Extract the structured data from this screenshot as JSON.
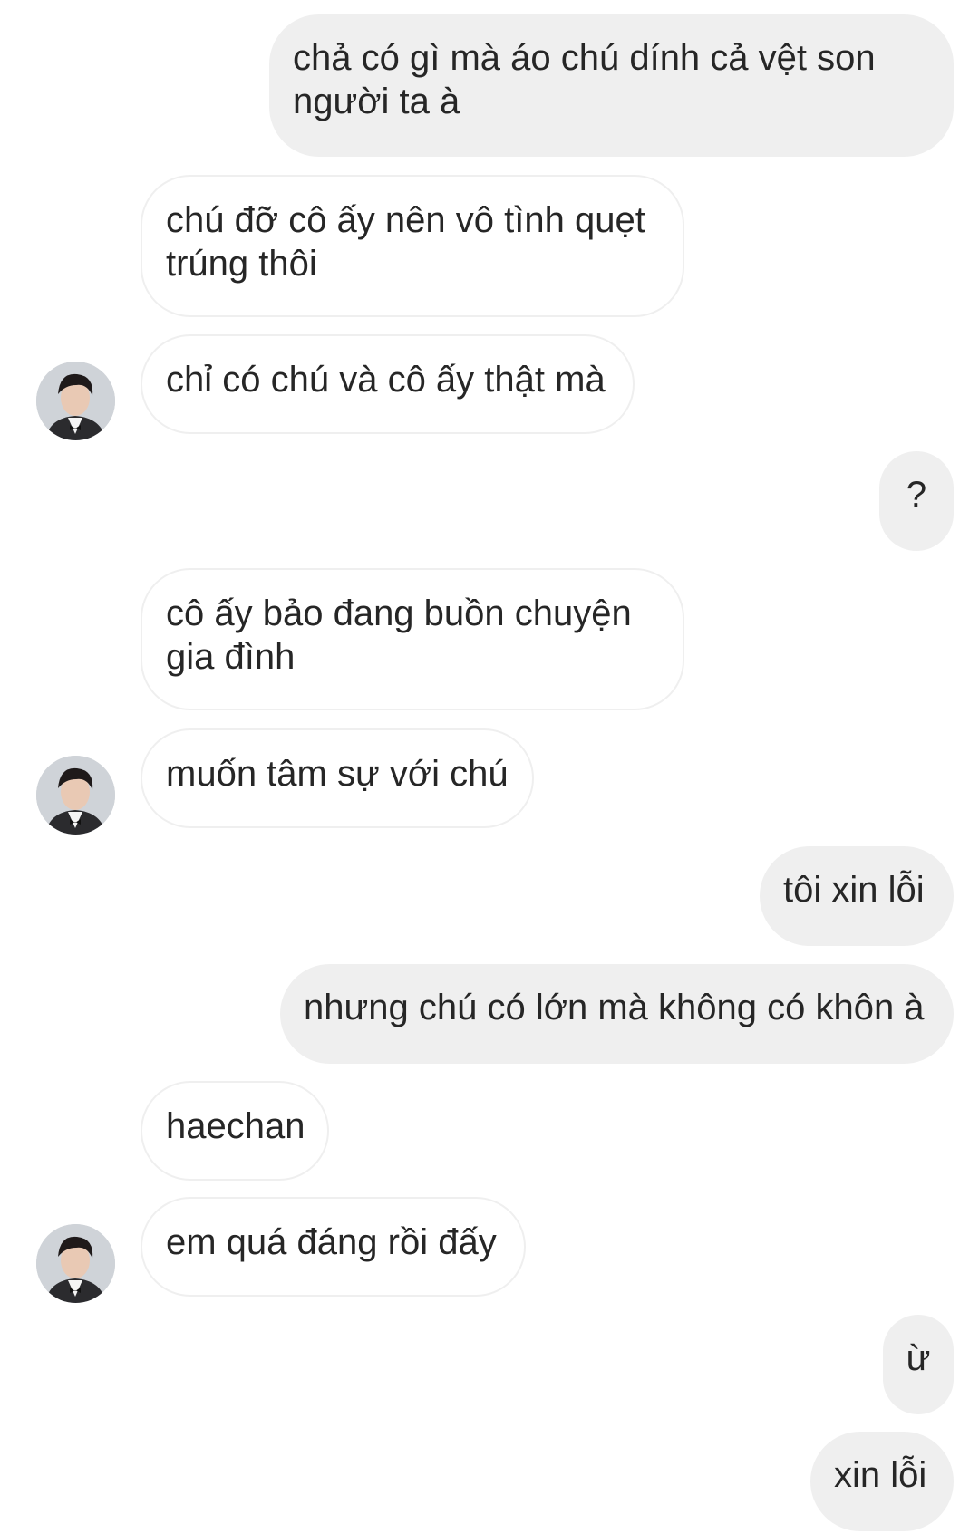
{
  "conversation": {
    "messages": [
      {
        "sender": "me",
        "text": "chả có gì mà áo chú dính cả vệt son người ta à"
      },
      {
        "sender": "them",
        "text": "chú đỡ cô ấy nên vô tình quẹt trúng thôi"
      },
      {
        "sender": "them",
        "text": "chỉ có chú và cô ấy thật mà",
        "avatar": "contact-avatar"
      },
      {
        "sender": "me",
        "text": "?"
      },
      {
        "sender": "them",
        "text": "cô ấy bảo đang buồn chuyện gia đình"
      },
      {
        "sender": "them",
        "text": "muốn tâm sự với chú",
        "avatar": "contact-avatar"
      },
      {
        "sender": "me",
        "text": "tôi xin lỗi"
      },
      {
        "sender": "me",
        "text": "nhưng chú có lớn mà không có khôn à"
      },
      {
        "sender": "them",
        "text": "haechan"
      },
      {
        "sender": "them",
        "text": "em quá đáng rồi đấy",
        "avatar": "contact-avatar"
      },
      {
        "sender": "me",
        "text": "ừ"
      },
      {
        "sender": "me",
        "text": "xin lỗi"
      }
    ]
  },
  "colors": {
    "sent_bubble": "#efefef",
    "received_border": "#efefef",
    "text": "#262626",
    "background": "#ffffff"
  }
}
